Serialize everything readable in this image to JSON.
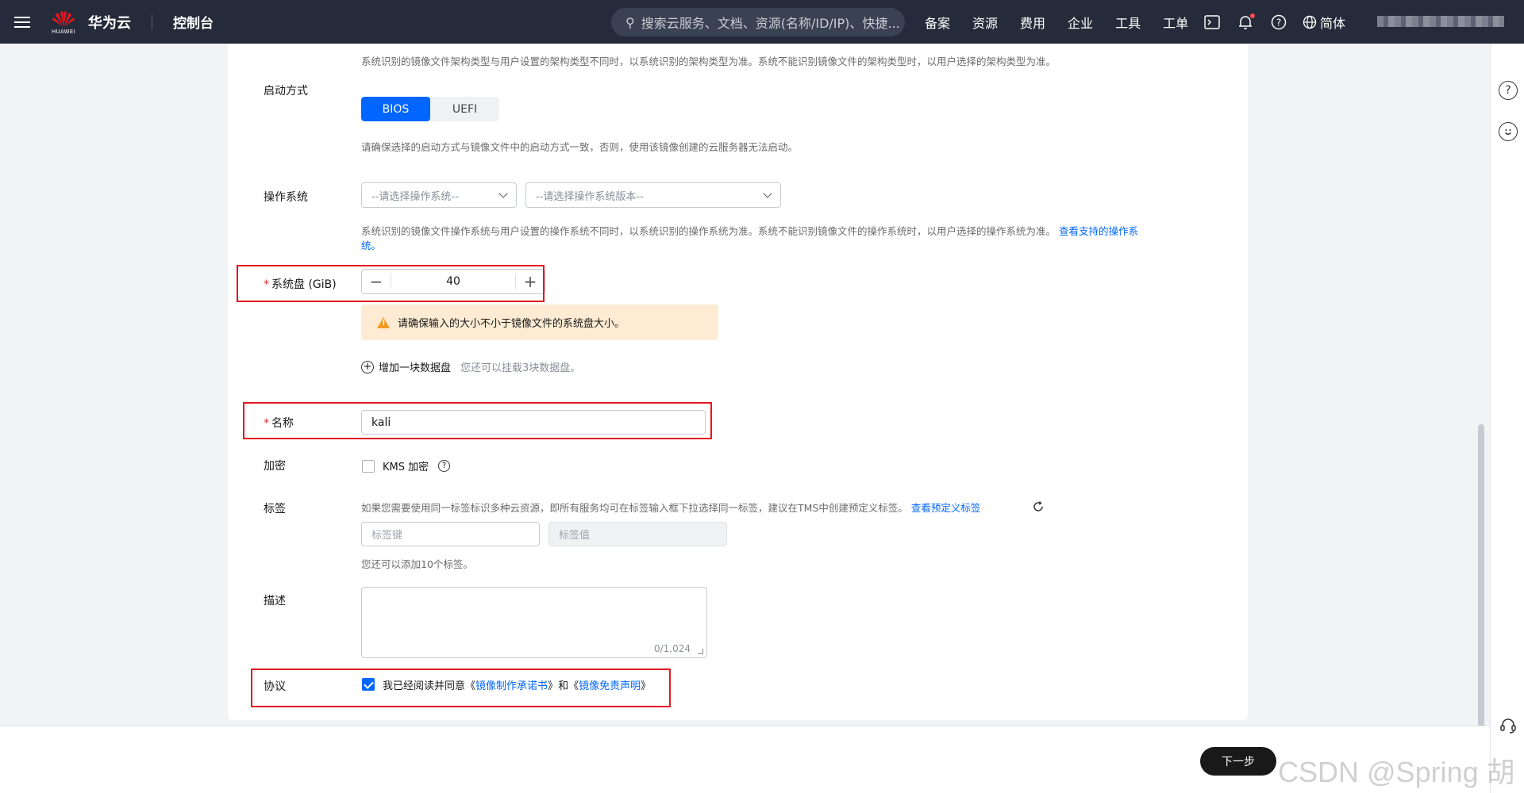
{
  "topbar": {
    "brand": "华为云",
    "logo_text": "HUAWEI",
    "console": "控制台",
    "search_placeholder": "搜索云服务、文档、资源(名称/ID/IP)、快捷...",
    "nav": [
      "备案",
      "资源",
      "费用",
      "企业",
      "工具",
      "工单"
    ],
    "lang": "简体"
  },
  "form": {
    "arch_hint": "系统识别的镜像文件架构类型与用户设置的架构类型不同时，以系统识别的架构类型为准。系统不能识别镜像文件的架构类型时，以用户选择的架构类型为准。",
    "boot_label": "启动方式",
    "boot_options": [
      "BIOS",
      "UEFI"
    ],
    "boot_selected": "BIOS",
    "boot_hint": "请确保选择的启动方式与镜像文件中的启动方式一致，否则，使用该镜像创建的云服务器无法启动。",
    "os_label": "操作系统",
    "os_select_placeholder": "--请选择操作系统--",
    "os_version_placeholder": "--请选择操作系统版本--",
    "os_hint": "系统识别的镜像文件操作系统与用户设置的操作系统不同时，以系统识别的操作系统为准。系统不能识别镜像文件的操作系统时，以用户选择的操作系统为准。",
    "os_hint_link_a": "查看支持的操作系",
    "os_hint_link_b": "统。",
    "disk_label": "系统盘 (GiB)",
    "disk_value": "40",
    "disk_warning": "请确保输入的大小不小于镜像文件的系统盘大小。",
    "add_disk": "增加一块数据盘",
    "add_disk_hint": "您还可以挂载3块数据盘。",
    "name_label": "名称",
    "name_value": "kali",
    "encrypt_label": "加密",
    "encrypt_option": "KMS 加密",
    "tag_label": "标签",
    "tag_hint": "如果您需要使用同一标签标识多种云资源，即所有服务均可在标签输入框下拉选择同一标签，建议在TMS中创建预定义标签。",
    "tag_hint_link": "查看预定义标签",
    "tag_key_placeholder": "标签键",
    "tag_value_placeholder": "标签值",
    "tag_limit": "您还可以添加10个标签。",
    "desc_label": "描述",
    "desc_count": "0/1,024",
    "agreement_label": "协议",
    "agreement_prefix": "我已经阅读并同意",
    "agreement_doc1": "镜像制作承诺书",
    "agreement_and": "和",
    "agreement_doc2": "镜像免责声明",
    "agreement_checked": true
  },
  "footer": {
    "next_label": "下一步",
    "watermark": "CSDN @Spring 胡"
  },
  "colors": {
    "primary": "#0066ff",
    "danger": "#e3171f",
    "topbar": "#252b3a",
    "warning_bg": "#fdebd3"
  }
}
